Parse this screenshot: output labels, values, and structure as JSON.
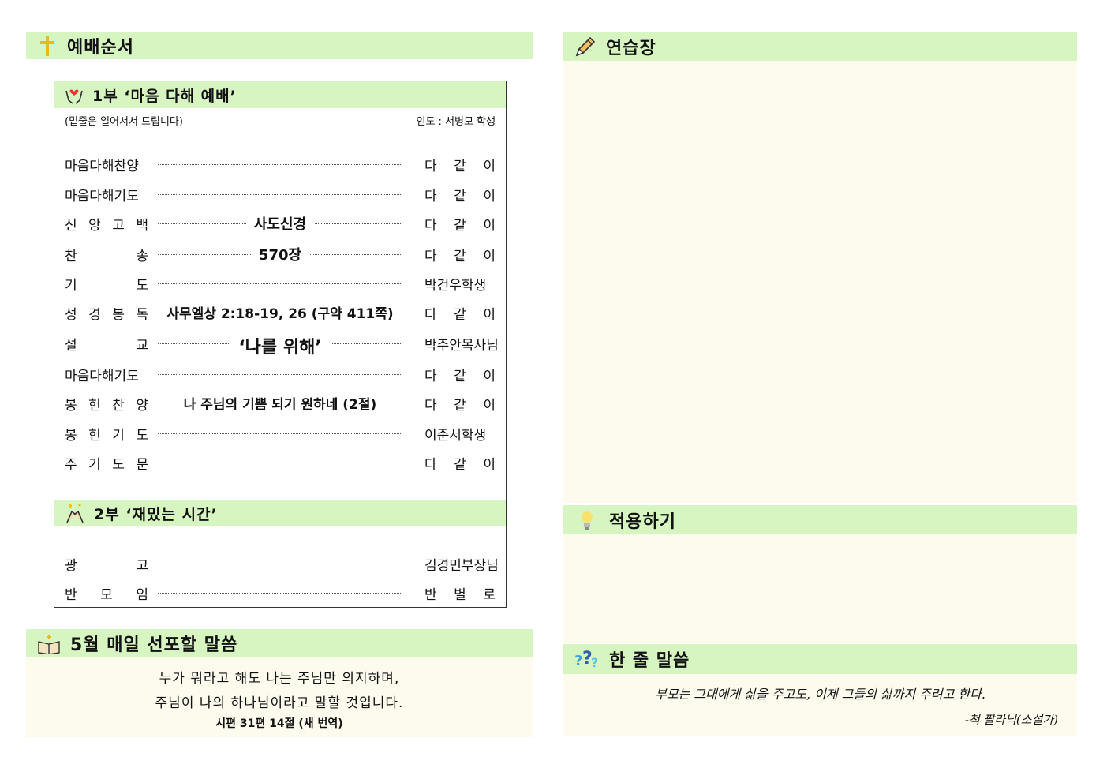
{
  "worship": {
    "header_title": "예배순서",
    "part1": {
      "title": "1부 ‘마음 다해 예배’",
      "note_left": "(밑줄은 일어서서 드립니다)",
      "note_right": "인도 : 서병모 학생",
      "rows": [
        {
          "label": "마음다해찬양",
          "middle": "",
          "who": "다 같 이"
        },
        {
          "label": "마음다해기도",
          "middle": "",
          "who": "다 같 이"
        },
        {
          "label": "신 앙 고 백",
          "middle": "사도신경",
          "who": "다 같 이"
        },
        {
          "label": "찬 송",
          "middle": "570장",
          "who": "다 같 이"
        },
        {
          "label": "기 도",
          "middle": "",
          "who": "박건우학생"
        },
        {
          "label": "성 경 봉 독",
          "middle": "사무엘상 2:18-19, 26 (구약 411쪽)",
          "who": "다 같 이"
        },
        {
          "label": "설 교",
          "middle": "‘나를 위해’",
          "who": "박주안목사님"
        },
        {
          "label": "마음다해기도",
          "middle": "",
          "who": "다 같 이"
        },
        {
          "label": "봉 헌 찬 양",
          "middle": "나 주님의 기쁨 되기 원하네 (2절)",
          "who": "다 같 이"
        },
        {
          "label": "봉 헌 기 도",
          "middle": "",
          "who": "이준서학생"
        },
        {
          "label": "주 기 도 문",
          "middle": "",
          "who": "다 같 이"
        }
      ]
    },
    "part2": {
      "title": "2부 ‘재밌는 시간’",
      "rows": [
        {
          "label": "광 고",
          "middle": "",
          "who": "김경민부장님"
        },
        {
          "label": "반 모 임",
          "middle": "",
          "who": "반 별 로"
        }
      ]
    }
  },
  "verse": {
    "header_title": "5월 매일 선포할 말씀",
    "line1": "누가 뭐라고 해도 나는 주님만 의지하며,",
    "line2": "주님이 나의 하나님이라고 말할 것입니다.",
    "reference": "시편 31편 14절 (새 번역)"
  },
  "practice": {
    "header_title": "연습장"
  },
  "apply": {
    "header_title": "적용하기"
  },
  "oneline": {
    "header_title": "한 줄 말씀",
    "quote": "부모는 그대에게 삶을 주고도, 이제 그들의 삶까지 주려고 한다.",
    "author": "-척 팔라닉(소설가)"
  },
  "colors": {
    "header_green": "#d7f5c1",
    "panel_cream": "#fdfbee",
    "cross_gold": "#e8b923"
  },
  "icons": [
    "cross-icon",
    "praying-hands-heart-icon",
    "high-five-icon",
    "bible-icon",
    "pencil-icon",
    "lightbulb-icon",
    "question-marks-icon"
  ]
}
